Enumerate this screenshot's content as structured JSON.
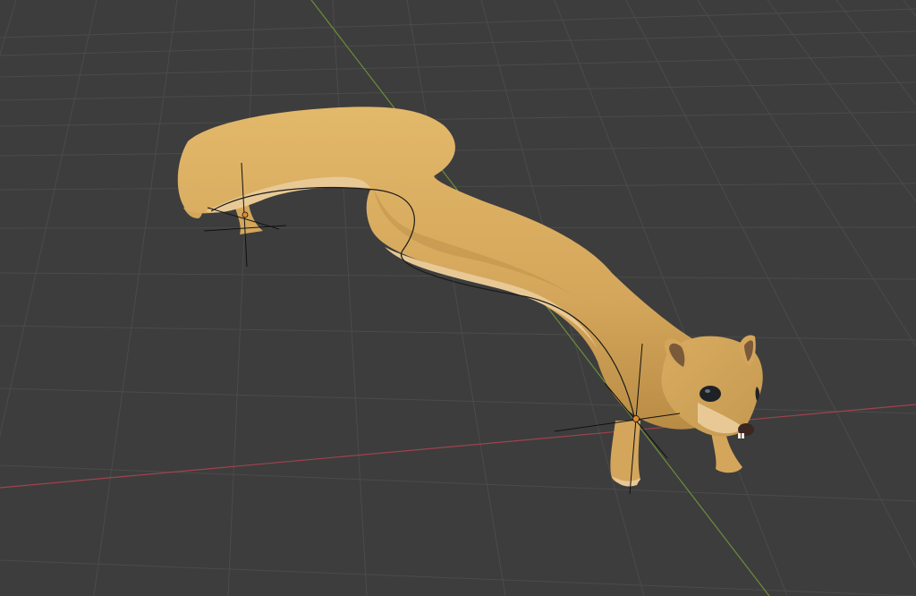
{
  "viewport": {
    "background": "#3d3d3d",
    "grid_color": "#4b4b4b",
    "x_axis_color": "#a1424d",
    "y_axis_color": "#6c8e3a"
  },
  "model": {
    "body_color": "#d4a65b",
    "belly_color": "#e8c996",
    "shadow_color": "#a77d3a",
    "ear_color": "#7a5a3b",
    "eye_color": "#1e2226",
    "nose_color": "#3b2620",
    "curve_color": "#1b1b1b"
  },
  "gizmo": {
    "origin_marker_color": "#e38a2a",
    "empty_color": "#111111"
  }
}
